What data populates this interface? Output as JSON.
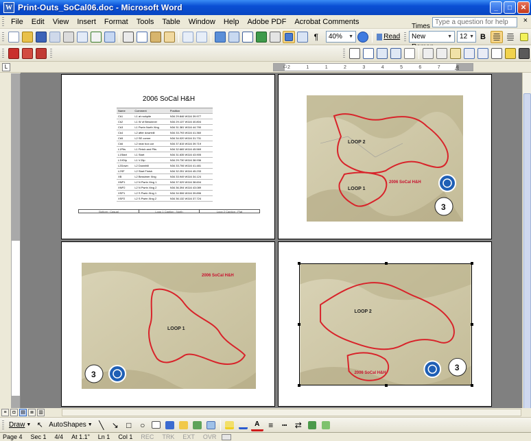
{
  "window": {
    "title": "Print-Outs_SoCal06.doc - Microsoft Word",
    "buttons": [
      "_",
      "□",
      "✕"
    ]
  },
  "menu": {
    "items": [
      "File",
      "Edit",
      "View",
      "Insert",
      "Format",
      "Tools",
      "Table",
      "Window",
      "Help",
      "Adobe PDF",
      "Acrobat Comments"
    ],
    "help_placeholder": "Type a question for help",
    "close_glyph": "×"
  },
  "toolbar": {
    "zoom": "40%",
    "read_label": "Read",
    "font": "Times New Roman",
    "font_size": "12",
    "bold": "B",
    "pilcrow": "¶"
  },
  "ruler": {
    "corner": "L",
    "ticks": [
      "2",
      "1",
      "1",
      "2",
      "3",
      "4",
      "5",
      "6",
      "7",
      "8"
    ]
  },
  "page1": {
    "title": "2006 SoCal H&H",
    "headers": [
      "Name",
      "Comment",
      "Position"
    ],
    "rows": [
      [
        "Ck1",
        "L1 at rockpile",
        "N34 29.846 W116 39.977"
      ],
      [
        "Ck2",
        "L1 W of Bessinner",
        "N34 29.137 W116 40.804"
      ],
      [
        "Ck3",
        "L1 Pwrin North Xing",
        "N34 31.381 W116 44.790"
      ],
      [
        "Ck4",
        "L2 after downhill",
        "N34 33.793 W116 41.360"
      ],
      [
        "Ck5",
        "L2 SE corner",
        "N34 34.020 W116 31.731"
      ],
      [
        "Ck6",
        "L2 near box car",
        "N34 37.815 W116 39.719"
      ],
      [
        "L1Pits",
        "L1 Finish and Pits",
        "N34 32.665 W116 45.569"
      ],
      [
        "L1Start",
        "L1 Start",
        "N34 31.635 W116 43.905"
      ],
      [
        "L1VDip",
        "L1 V-Dip",
        "N34 29.730 W116 38.936"
      ],
      [
        "L2Down",
        "L2 Downhill",
        "N34 33.706 W116 41.481"
      ],
      [
        "L2SF",
        "L2 Start Finish",
        "N34 32.251 W116 45.233"
      ],
      [
        "XB",
        "L2 Bessimer Xing",
        "N34 33.949 W116 34.124"
      ],
      [
        "XNP1",
        "L2 N Pwrin Xing 1",
        "N34 37.029 W116 38.604"
      ],
      [
        "XNP2",
        "L2 N Pwrin Xing 2",
        "N34 36.394 W116 43.089"
      ],
      [
        "XSP1",
        "L2 S Pwrin Xing 1",
        "N34 34.506 W116 39.896"
      ],
      [
        "XSP2",
        "L2 S Pwrin Xing 2",
        "N34 36.132 W116 37.724"
      ]
    ],
    "footer": [
      "Bottom : Casual",
      "Loop 1 Caption : North",
      "Loop 2 Caption : Plat"
    ]
  },
  "maps": {
    "label_event": "2006 SoCal H&H",
    "label_loop1": "LOOP 1",
    "label_loop2": "LOOP 2",
    "badge_number": "3"
  },
  "status": {
    "page": "Page 4",
    "sec": "Sec 1",
    "pages": "4/4",
    "at": "At 1.1\"",
    "ln": "Ln 1",
    "col": "Col 1",
    "modes": [
      "REC",
      "TRK",
      "EXT",
      "OVR"
    ]
  },
  "drawbar": {
    "draw": "Draw",
    "autoshapes": "AutoShapes"
  },
  "colors": {
    "route": "#d8232a",
    "event_label": "#c8102e",
    "terrain": "#cfc8a8"
  }
}
